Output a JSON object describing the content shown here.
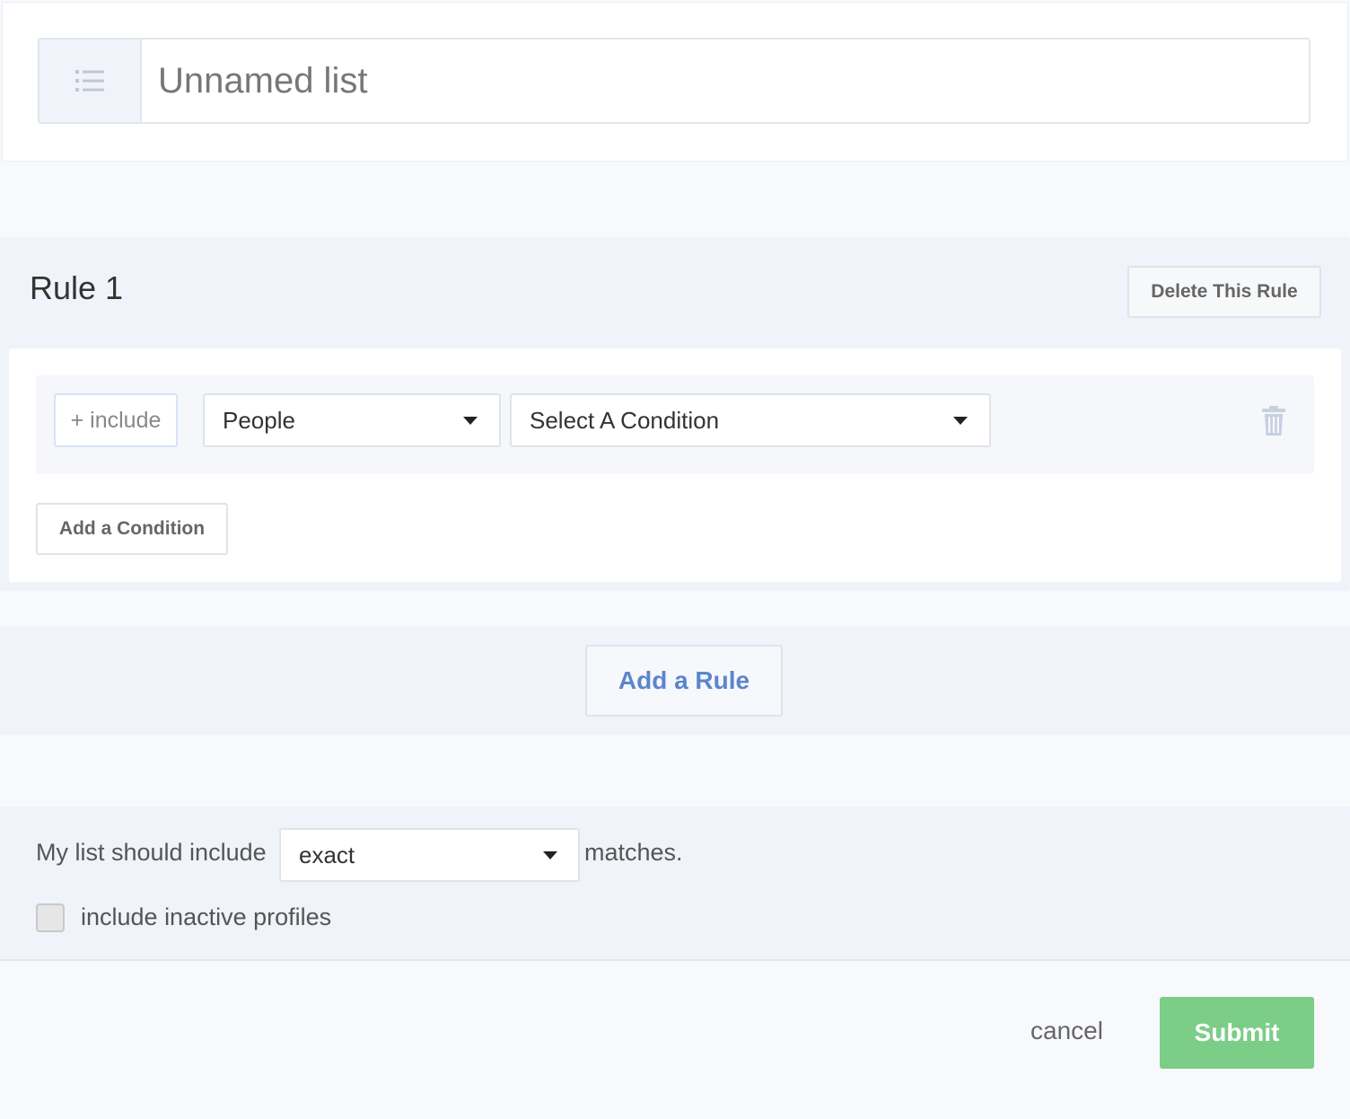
{
  "list_name": {
    "placeholder": "Unnamed list",
    "icon": "list-icon"
  },
  "rule": {
    "title": "Rule 1",
    "delete_label": "Delete This Rule",
    "condition": {
      "include_label": "+ include",
      "entity_select": "People",
      "condition_select": "Select A Condition",
      "delete_icon": "trash-icon"
    },
    "add_condition_label": "Add a Condition"
  },
  "add_rule_label": "Add a Rule",
  "settings": {
    "prefix": "My list should include",
    "match_select": "exact",
    "suffix": "matches.",
    "inactive_label": "include inactive profiles",
    "inactive_checked": false
  },
  "footer": {
    "cancel_label": "cancel",
    "submit_label": "Submit"
  },
  "colors": {
    "accent_link": "#5b86cc",
    "submit_green": "#7bcd88",
    "section_bg": "#f0f3f9"
  }
}
